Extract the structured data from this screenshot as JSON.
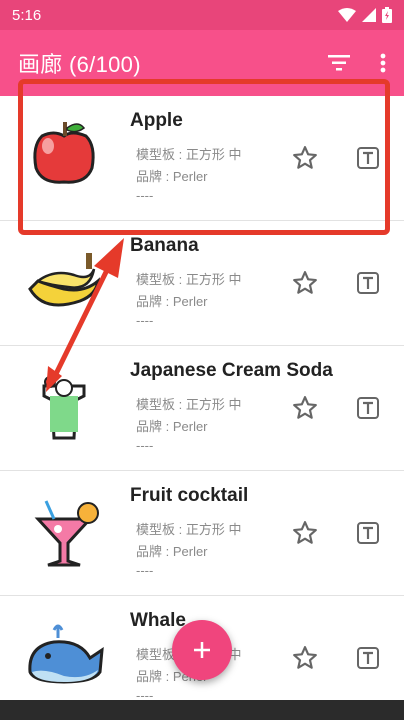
{
  "status_bar": {
    "time": "5:16"
  },
  "app_bar": {
    "title": "画廊 (6/100)",
    "sort_icon": "sort-icon",
    "more_icon": "more-vert-icon"
  },
  "items": [
    {
      "title": "Apple",
      "board": "模型板 : 正方形 中",
      "brand": "品牌 : Perler",
      "note": "----"
    },
    {
      "title": "Banana",
      "board": "模型板 : 正方形 中",
      "brand": "品牌 : Perler",
      "note": "----"
    },
    {
      "title": "Japanese Cream Soda",
      "board": "模型板 : 正方形 中",
      "brand": "品牌 : Perler",
      "note": "----"
    },
    {
      "title": "Fruit cocktail",
      "board": "模型板 : 正方形 中",
      "brand": "品牌 : Perler",
      "note": "----"
    },
    {
      "title": "Whale",
      "board": "模型板 : 正方形 中",
      "brand": "品牌 : Perler",
      "note": "----"
    }
  ],
  "fab": {
    "label": "+"
  },
  "colors": {
    "status_bar": "#e8457a",
    "app_bar": "#f7508a",
    "fab": "#f0457d",
    "annotation": "#e53a2a"
  }
}
